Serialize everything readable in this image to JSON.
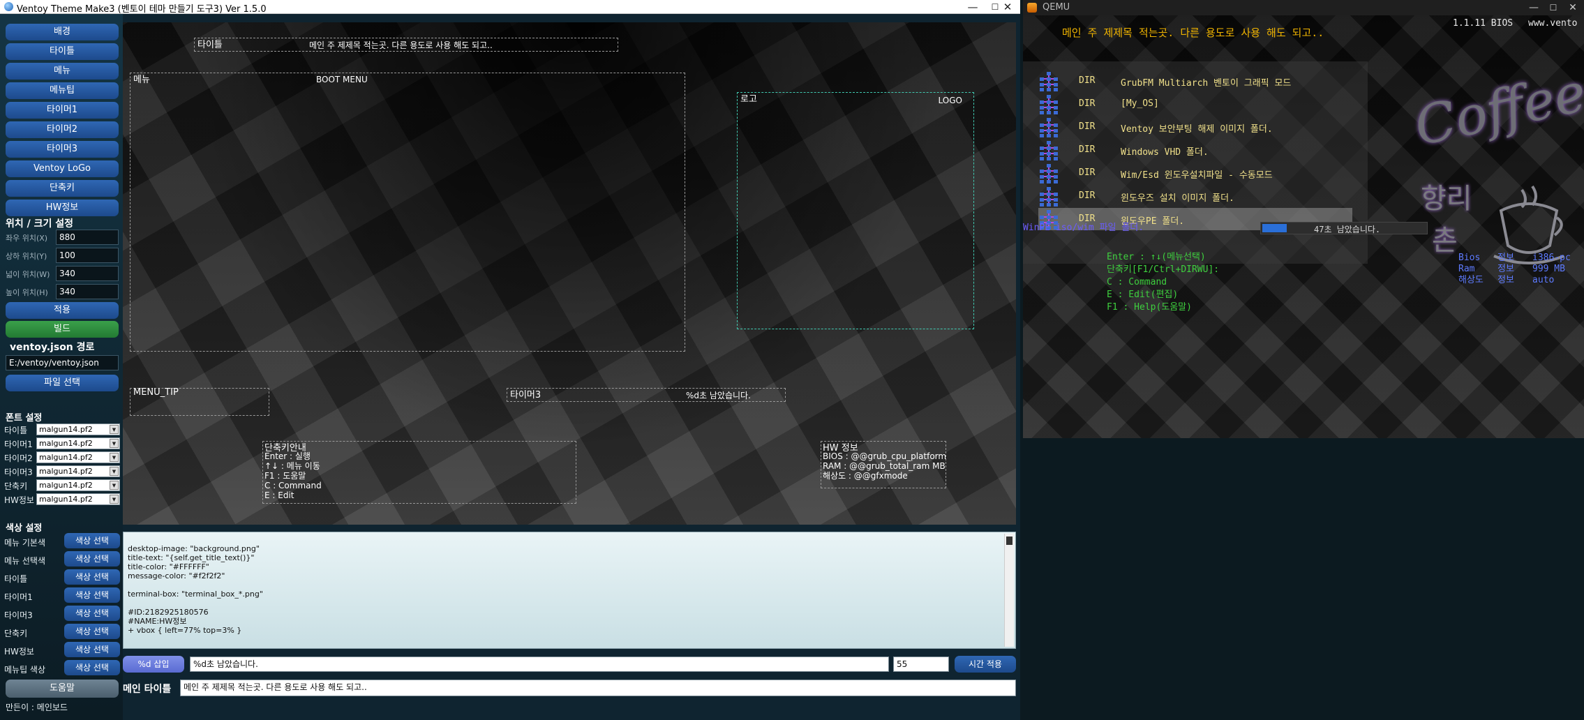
{
  "app": {
    "title": "Ventoy Theme Make3 (벤토이 테마 만들기 도구3)   Ver 1.5.0",
    "minimize": "—",
    "maximize": "☐",
    "close": "✕"
  },
  "sidebar": {
    "items": [
      "배경",
      "타이틀",
      "메뉴",
      "메뉴팁",
      "타이머1",
      "타이머2",
      "타이머3",
      "Ventoy LoGo",
      "단축키",
      "HW정보"
    ],
    "position_section_label": "위치 / 크기 설정",
    "fields": [
      {
        "label": "좌우 위치(X)",
        "value": "880"
      },
      {
        "label": "상하 위치(Y)",
        "value": "100"
      },
      {
        "label": "넓이 위치(W)",
        "value": "340"
      },
      {
        "label": "높이 위치(H)",
        "value": "340"
      }
    ],
    "apply_button": "적용",
    "build_button": "빌드",
    "json_path_label": "ventoy.json 경로",
    "json_path_value": "E:/ventoy/ventoy.json",
    "file_select_button": "파일 선택",
    "font_section_label": "폰트 설정",
    "fonts": [
      {
        "label": "타이틀",
        "value": "malgun14.pf2"
      },
      {
        "label": "타이머1",
        "value": "malgun14.pf2"
      },
      {
        "label": "타이머2",
        "value": "malgun14.pf2"
      },
      {
        "label": "타이머3",
        "value": "malgun14.pf2"
      },
      {
        "label": "단축키",
        "value": "malgun14.pf2"
      },
      {
        "label": "HW정보",
        "value": "malgun14.pf2"
      }
    ],
    "color_section_label": "색상 설정",
    "colors": [
      {
        "label": "메뉴 기본색",
        "button": "색상 선택"
      },
      {
        "label": "메뉴 선택색",
        "button": "색상 선택"
      },
      {
        "label": "타이틀",
        "button": "색상 선택"
      },
      {
        "label": "타이머1",
        "button": "색상 선택"
      },
      {
        "label": "타이머3",
        "button": "색상 선택"
      },
      {
        "label": "단축키",
        "button": "색상 선택"
      },
      {
        "label": "HW정보",
        "button": "색상 선택"
      },
      {
        "label": "메뉴팁 색상",
        "button": "색상 선택"
      }
    ],
    "help_button": "도움말",
    "author": "만든이 : 메인보드"
  },
  "preview": {
    "title_label": "타이틀",
    "title_text": "메인 주 제제목 적는곳. 다른 용도로 사용 해도 되고..",
    "menu_label": "메뉴",
    "menu_text": "BOOT MENU",
    "logo_label": "로고",
    "logo_text": "LOGO",
    "menu_tip_label": "MENU_TIP",
    "timer3_label": "타이머3",
    "timer3_text": "%d초 남았습니다.",
    "hotkey_title": "단축키안내",
    "hotkey_lines": [
      "Enter : 실행",
      "↑↓ : 메뉴 이동",
      "F1 : 도움말",
      "C : Command",
      "E : Edit"
    ],
    "hw_title": "HW 정보",
    "hw_lines": [
      "BIOS : @@grub_cpu_platform",
      "RAM : @@grub_total_ram MB",
      "해상도 : @@gfxmode"
    ]
  },
  "code": {
    "lines": [
      "",
      "desktop-image: \"background.png\"",
      "title-text: \"{self.get_title_text()}\"",
      "title-color: \"#FFFFFF\"",
      "message-color: \"#f2f2f2\"",
      "",
      "terminal-box: \"terminal_box_*.png\"",
      "",
      "#ID:2182925180576",
      "#NAME:HW정보",
      "+ vbox { left=77% top=3% }"
    ]
  },
  "timer_row": {
    "insert_button": "%d 삽입",
    "text_value": "%d초 남았습니다.",
    "seconds_value": "55",
    "apply_button": "시간 적용"
  },
  "main_title_row": {
    "label": "메인 타이틀",
    "value": "메인 주 제제목 적는곳. 다른 용도로 사용 해도 되고.."
  },
  "qemu": {
    "window_title": "QEMU",
    "bios_version": "1.1.11 BIOS",
    "www": "www.vento",
    "title": "메인 주 제제목 적는곳. 다른 용도로 사용 해도 되고..",
    "menu_items": [
      {
        "tag": "DIR",
        "text": "GrubFM Multiarch 벤토이 그래픽 모드"
      },
      {
        "tag": "DIR",
        "text": "[My_OS]"
      },
      {
        "tag": "DIR",
        "text": "Ventoy 보안부팅 해제 이미지 폴더."
      },
      {
        "tag": "DIR",
        "text": "Windows VHD 폴더."
      },
      {
        "tag": "DIR",
        "text": "Wim/Esd 윈도우설치파일 - 수동모드"
      },
      {
        "tag": "DIR",
        "text": "윈도우즈 설치 이미지 폴더."
      },
      {
        "tag": "DIR",
        "text": "윈도우PE 폴더."
      }
    ],
    "menu_tip": "WinPE iso/wim 파일 폴더.",
    "timer_text": "47초 남았습니다.",
    "timer_fill": 0.15,
    "hotkeys": [
      "Enter : ↑↓(메뉴선택)",
      "단축키[F1/Ctrl+DIRWU]:",
      "C  : Command",
      "E  : Edit(편집)",
      "F1 : Help(도움말)"
    ],
    "hw": [
      {
        "k": "Bios",
        "k2": "정보",
        "v": "i386-pc"
      },
      {
        "k": "Ram",
        "k2": "정보",
        "v": "999 MB"
      },
      {
        "k": "해상도",
        "k2": "정보",
        "v": "auto"
      }
    ],
    "logo_text_1": "Coffee",
    "logo_text_2": "향리",
    "logo_text_3": "촌"
  },
  "colors": {
    "title_color": "#f0b400",
    "menu_color": "#f0e08a",
    "tip_color": "#6a5cff",
    "hotkey_color": "#3ecf3e",
    "hw_color": "#5e7bff"
  }
}
